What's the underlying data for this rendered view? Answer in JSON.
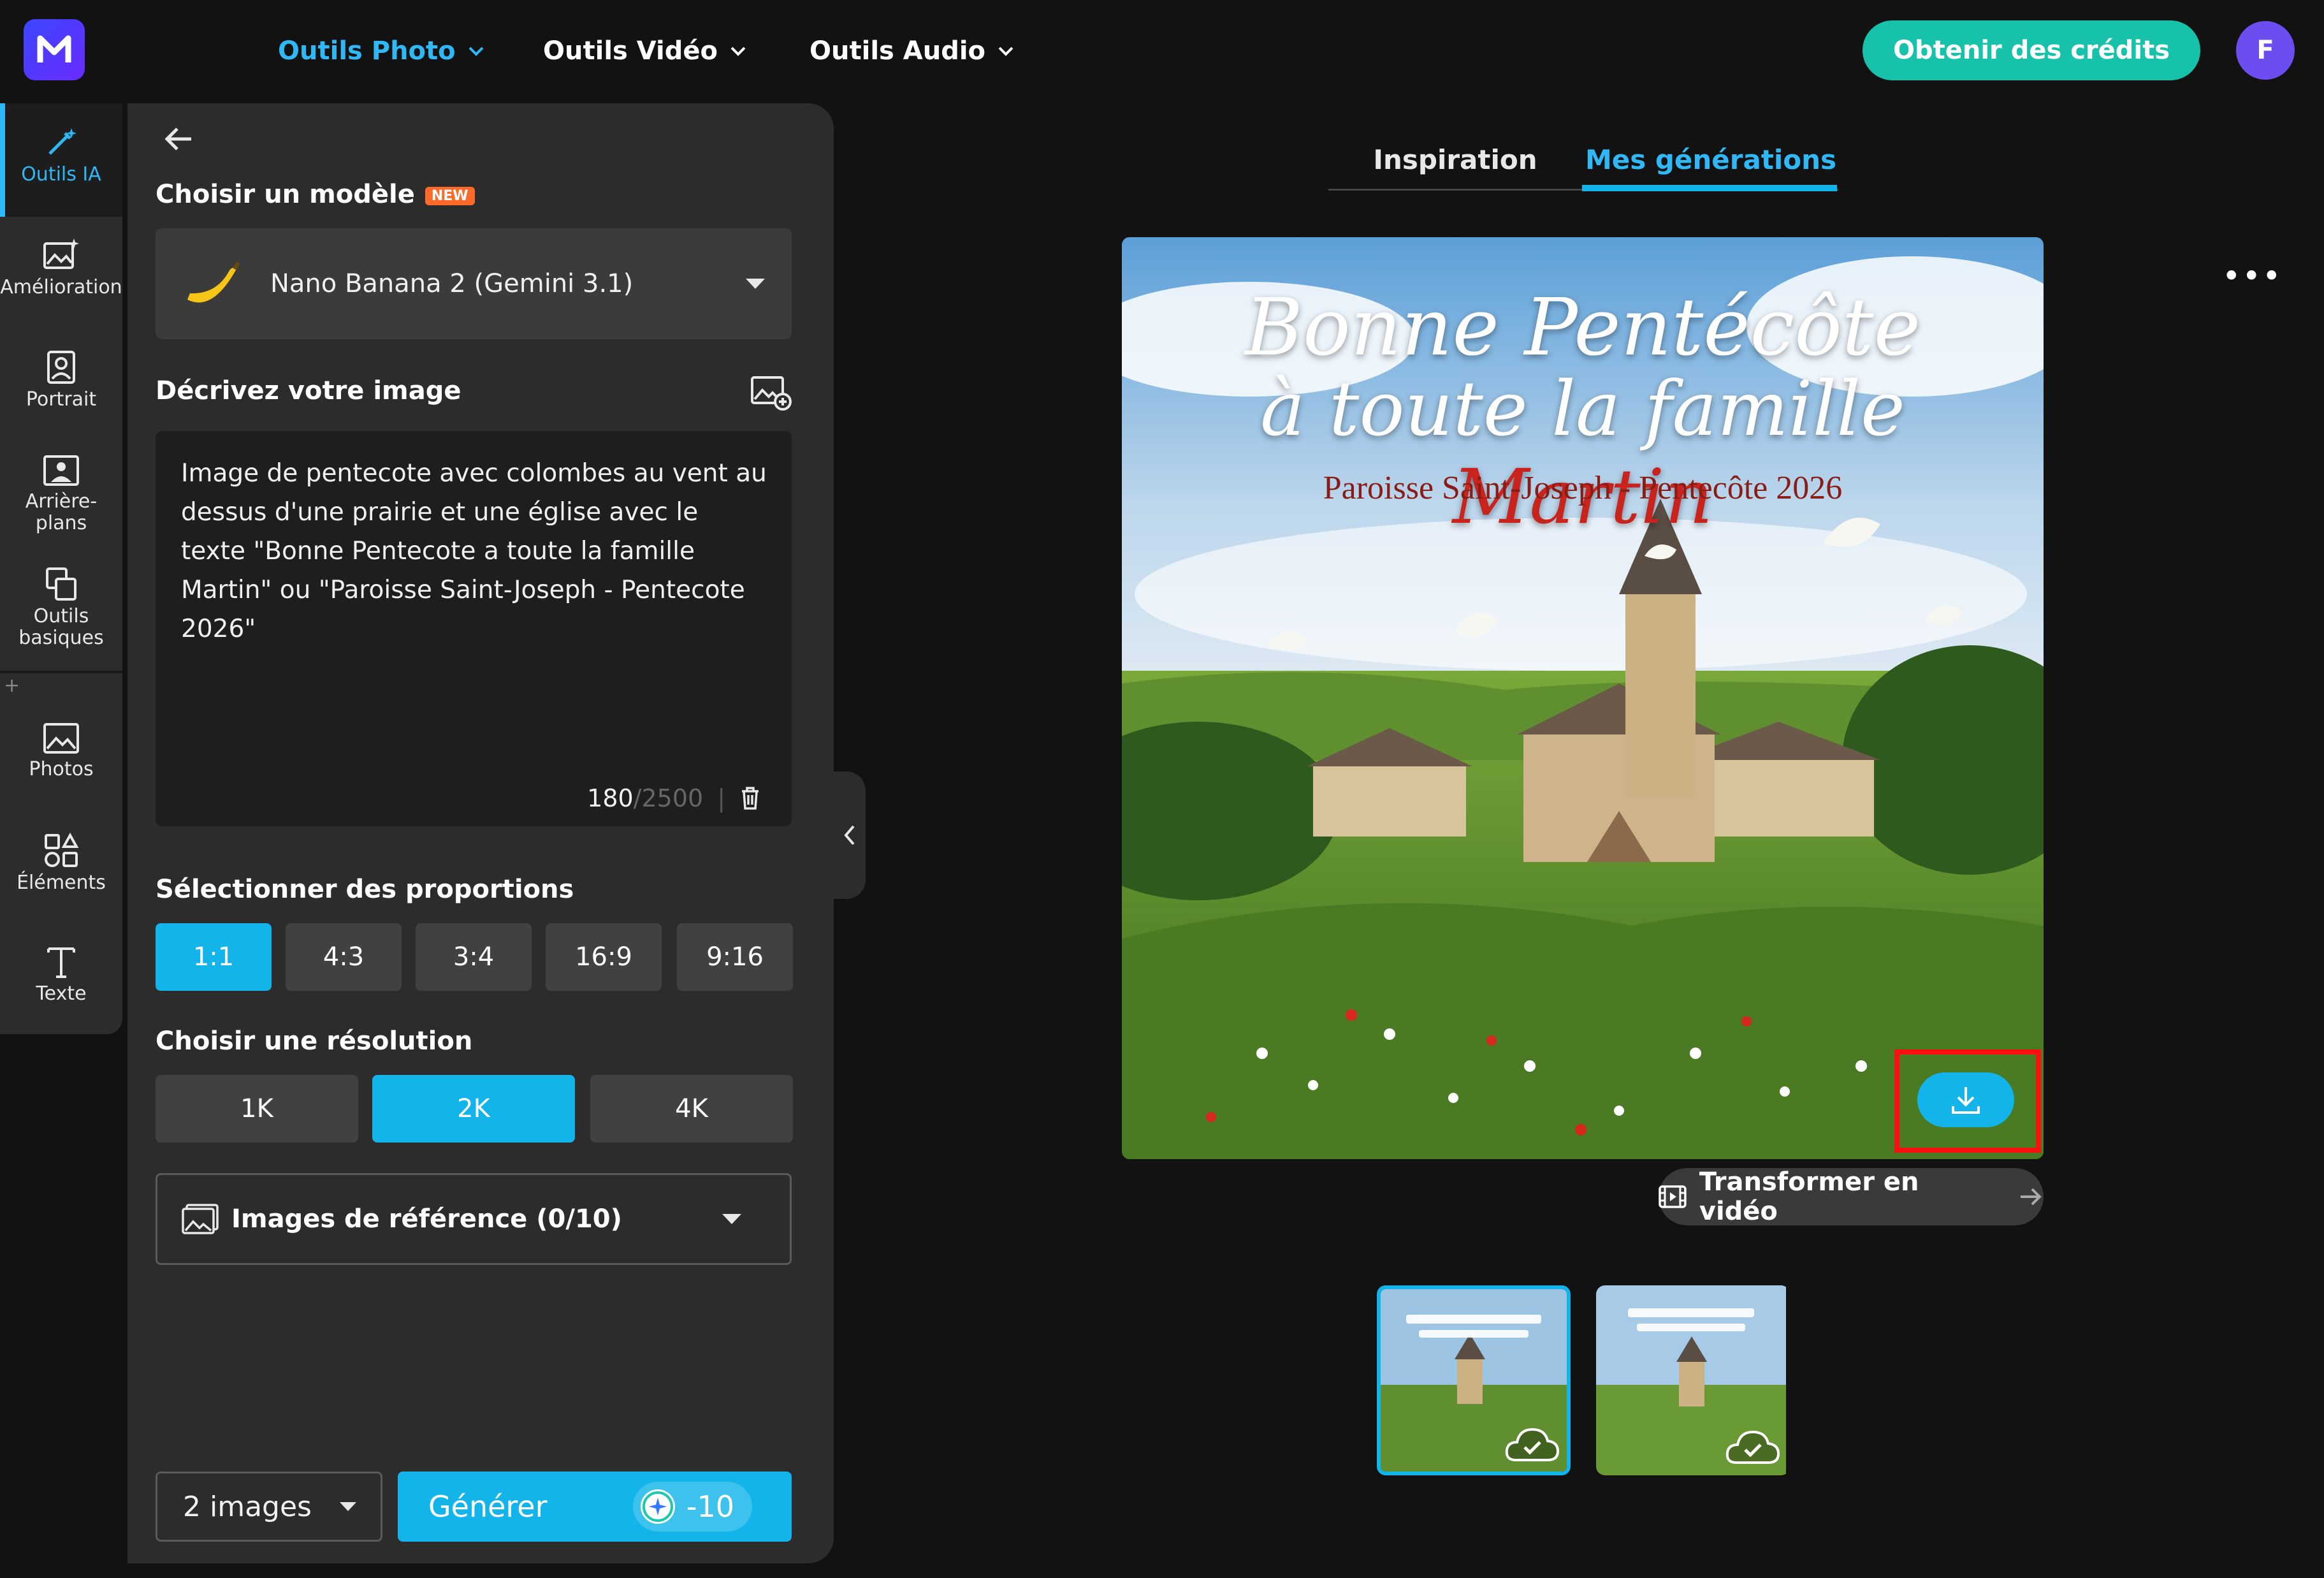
{
  "nav": {
    "photo": "Outils Photo",
    "video": "Outils Vidéo",
    "audio": "Outils Audio",
    "credits": "Obtenir des crédits",
    "avatar": "F"
  },
  "rail": {
    "items": [
      {
        "label": "Outils IA",
        "icon": "magic-wand-icon"
      },
      {
        "label": "Amélioration",
        "icon": "image-enhance-icon"
      },
      {
        "label": "Portrait",
        "icon": "portrait-icon"
      },
      {
        "label": "Arrière-plans",
        "icon": "background-icon"
      },
      {
        "label": "Outils basiques",
        "icon": "basic-tools-icon"
      },
      {
        "label": "Photos",
        "icon": "photos-icon"
      },
      {
        "label": "Éléments",
        "icon": "elements-icon"
      },
      {
        "label": "Texte",
        "icon": "text-icon"
      }
    ]
  },
  "panel": {
    "model_label": "Choisir un modèle",
    "new_badge": "NEW",
    "model_name": "Nano Banana 2 (Gemini 3.1)",
    "describe_label": "Décrivez votre image",
    "prompt": "Image de pentecote avec colombes au vent au dessus d'une prairie et une église avec le texte \"Bonne Pentecote a toute la famille Martin\" ou \"Paroisse Saint-Joseph - Pentecote 2026\"",
    "char_count": "180",
    "char_max": "/2500",
    "ratio_label": "Sélectionner des proportions",
    "ratios": [
      "1:1",
      "4:3",
      "3:4",
      "16:9",
      "9:16"
    ],
    "resolution_label": "Choisir une résolution",
    "resolutions": [
      "1K",
      "2K",
      "4K"
    ],
    "reference_label": "Images de référence (0/10)",
    "count_select": "2 images",
    "generate": "Générer",
    "cost": "-10"
  },
  "main": {
    "tabs": [
      "Inspiration",
      "Mes générations"
    ],
    "image_title_1": "Bonne Pentécôte",
    "image_title_2a": "à toute la famille ",
    "image_title_2b": "Martin",
    "image_subtitle": "Paroisse Saint-Joseph - Pentecôte 2026",
    "video_button": "Transformer en vidéo"
  },
  "colors": {
    "accent": "#13b4ea",
    "teal": "#17c2aa",
    "highlight": "#ff1010"
  }
}
